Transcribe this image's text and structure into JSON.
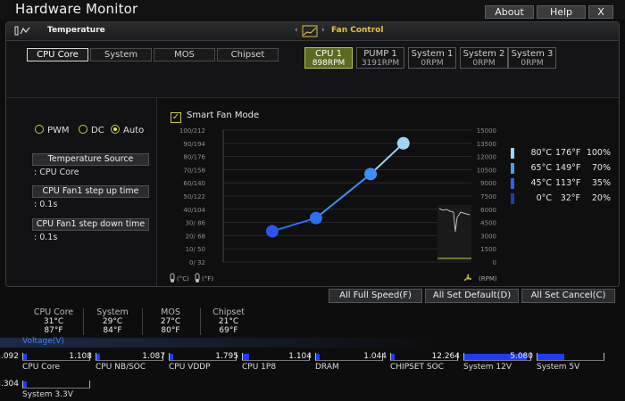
{
  "window": {
    "title": "Hardware Monitor",
    "buttons": {
      "about": "About",
      "help": "Help",
      "close": "X"
    }
  },
  "temperature_panel": {
    "title": "Temperature",
    "tabs": [
      "CPU Core",
      "System",
      "MOS",
      "Chipset"
    ],
    "active_tab": "CPU Core"
  },
  "fan_panel": {
    "title": "Fan Control",
    "fans": [
      {
        "name": "CPU 1",
        "rpm": "898RPM",
        "active": true
      },
      {
        "name": "PUMP 1",
        "rpm": "3191RPM",
        "active": false
      },
      {
        "name": "System 1",
        "rpm": "0RPM",
        "active": false
      },
      {
        "name": "System 2",
        "rpm": "0RPM",
        "active": false
      },
      {
        "name": "System 3",
        "rpm": "0RPM",
        "active": false
      }
    ]
  },
  "mode": {
    "pwm": "PWM",
    "dc": "DC",
    "auto": "Auto",
    "selected": "Auto"
  },
  "settings": {
    "temp_source_label": "Temperature Source",
    "temp_source_value": ": CPU Core",
    "step_up_label": "CPU Fan1 step up time",
    "step_up_value": ": 0.1s",
    "step_down_label": "CPU Fan1 step down time",
    "step_down_value": ": 0.1s"
  },
  "smart_fan": {
    "label": "Smart Fan Mode",
    "checked": true,
    "check_glyph": "✓"
  },
  "chart_data": {
    "type": "line",
    "y_left_ticks": [
      "100/212",
      "90/194",
      "80/176",
      "70/158",
      "60/140",
      "50/122",
      "40/104",
      "30/ 86",
      "20/ 68",
      "10/ 50",
      "0/ 32"
    ],
    "y_right_ticks": [
      "15000",
      "13500",
      "12000",
      "10500",
      "9000",
      "7500",
      "6000",
      "4500",
      "3000",
      "1500",
      "0"
    ],
    "left_unit_labels": [
      "(°C)",
      "(°F)"
    ],
    "right_unit_label": "(RPM)",
    "series": [
      {
        "points": [
          {
            "temp_c": 20,
            "rpm": 3500
          },
          {
            "temp_c": 40,
            "rpm": 5000
          },
          {
            "temp_c": 65,
            "rpm": 10000
          },
          {
            "temp_c": 80,
            "rpm": 13500
          }
        ]
      }
    ],
    "xlim_c": [
      0,
      100
    ],
    "ylim_rpm": [
      0,
      15000
    ],
    "grid": true
  },
  "temp_legend": [
    {
      "c": "80°C",
      "f": "176°F",
      "pct": "100%",
      "color": "#9fd4f7"
    },
    {
      "c": "65°C",
      "f": "149°F",
      "pct": "70%",
      "color": "#4a9cf0"
    },
    {
      "c": "45°C",
      "f": "113°F",
      "pct": "35%",
      "color": "#2e64e6"
    },
    {
      "c": "0°C",
      "f": "32°F",
      "pct": "20%",
      "color": "#1d3db5"
    }
  ],
  "actions": {
    "full_speed": "All Full Speed(F)",
    "set_default": "All Set Default(D)",
    "set_cancel": "All Set Cancel(C)"
  },
  "temp_summary": [
    {
      "name": "CPU Core",
      "c": "31°C",
      "f": "87°F"
    },
    {
      "name": "System",
      "c": "29°C",
      "f": "84°F"
    },
    {
      "name": "MOS",
      "c": "27°C",
      "f": "80°F"
    },
    {
      "name": "Chipset",
      "c": "21°C",
      "f": "69°F"
    }
  ],
  "voltage": {
    "title": "Voltage(V)",
    "items": [
      {
        "name": "CPU Core",
        "value": "1.092",
        "fill": 0.06
      },
      {
        "name": "CPU NB/SOC",
        "value": "1.108",
        "fill": 0.06
      },
      {
        "name": "CPU VDDP",
        "value": "1.087",
        "fill": 0.06
      },
      {
        "name": "CPU 1P8",
        "value": "1.795",
        "fill": 0.1
      },
      {
        "name": "DRAM",
        "value": "1.104",
        "fill": 0.06
      },
      {
        "name": "CHIPSET SOC",
        "value": "1.044",
        "fill": 0.06
      },
      {
        "name": "System 12V",
        "value": "12.264",
        "fill": 0.95
      },
      {
        "name": "System 5V",
        "value": "5.080",
        "fill": 0.4
      },
      {
        "name": "System 3.3V",
        "value": "3.304",
        "fill": 0.06
      }
    ]
  }
}
